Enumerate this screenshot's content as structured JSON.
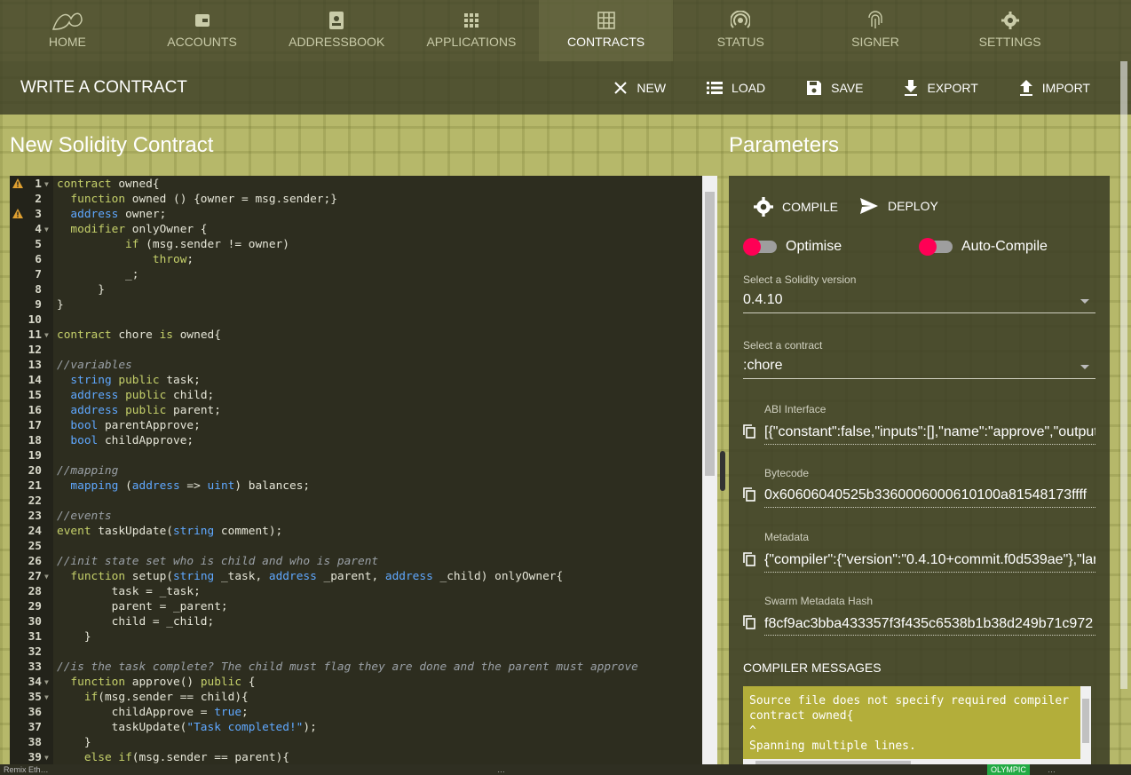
{
  "nav": {
    "items": [
      {
        "label": "HOME",
        "icon": "mist-logo-icon"
      },
      {
        "label": "ACCOUNTS",
        "icon": "wallet-icon"
      },
      {
        "label": "ADDRESSBOOK",
        "icon": "contact-book-icon"
      },
      {
        "label": "APPLICATIONS",
        "icon": "apps-grid-icon"
      },
      {
        "label": "CONTRACTS",
        "icon": "grid-table-icon",
        "active": true
      },
      {
        "label": "STATUS",
        "icon": "signal-icon"
      },
      {
        "label": "SIGNER",
        "icon": "fingerprint-icon"
      },
      {
        "label": "SETTINGS",
        "icon": "gear-icon"
      }
    ]
  },
  "toolbar": {
    "title": "WRITE A CONTRACT",
    "new_label": "NEW",
    "load_label": "LOAD",
    "save_label": "SAVE",
    "export_label": "EXPORT",
    "import_label": "IMPORT"
  },
  "editor": {
    "heading": "New Solidity Contract",
    "lines": [
      {
        "n": "1",
        "text": "contract owned{",
        "fold": true,
        "warn": true
      },
      {
        "n": "2",
        "text": "  function owned () {owner = msg.sender;}"
      },
      {
        "n": "3",
        "text": "  address owner;",
        "warn": true
      },
      {
        "n": "4",
        "text": "  modifier onlyOwner {",
        "fold": true
      },
      {
        "n": "5",
        "text": "          if (msg.sender != owner)"
      },
      {
        "n": "6",
        "text": "              throw;"
      },
      {
        "n": "7",
        "text": "          _;"
      },
      {
        "n": "8",
        "text": "      }"
      },
      {
        "n": "9",
        "text": "}"
      },
      {
        "n": "10",
        "text": ""
      },
      {
        "n": "11",
        "text": "contract chore is owned{",
        "fold": true
      },
      {
        "n": "12",
        "text": ""
      },
      {
        "n": "13",
        "text": "//variables"
      },
      {
        "n": "14",
        "text": "  string public task;"
      },
      {
        "n": "15",
        "text": "  address public child;"
      },
      {
        "n": "16",
        "text": "  address public parent;"
      },
      {
        "n": "17",
        "text": "  bool parentApprove;"
      },
      {
        "n": "18",
        "text": "  bool childApprove;"
      },
      {
        "n": "19",
        "text": ""
      },
      {
        "n": "20",
        "text": "//mapping"
      },
      {
        "n": "21",
        "text": "  mapping (address => uint) balances;"
      },
      {
        "n": "22",
        "text": ""
      },
      {
        "n": "23",
        "text": "//events"
      },
      {
        "n": "24",
        "text": "event taskUpdate(string comment);"
      },
      {
        "n": "25",
        "text": ""
      },
      {
        "n": "26",
        "text": "//init state set who is child and who is parent"
      },
      {
        "n": "27",
        "text": "  function setup(string _task, address _parent, address _child) onlyOwner{",
        "fold": true
      },
      {
        "n": "28",
        "text": "        task = _task;"
      },
      {
        "n": "29",
        "text": "        parent = _parent;"
      },
      {
        "n": "30",
        "text": "        child = _child;"
      },
      {
        "n": "31",
        "text": "    }"
      },
      {
        "n": "32",
        "text": ""
      },
      {
        "n": "33",
        "text": "//is the task complete? The child must flag they are done and the parent must approve"
      },
      {
        "n": "34",
        "text": "  function approve() public {",
        "fold": true
      },
      {
        "n": "35",
        "text": "    if(msg.sender == child){",
        "fold": true
      },
      {
        "n": "36",
        "text": "        childApprove = true;"
      },
      {
        "n": "37",
        "text": "        taskUpdate(\"Task completed!\");"
      },
      {
        "n": "38",
        "text": "    }"
      },
      {
        "n": "39",
        "text": "    else if(msg.sender == parent){",
        "fold": true
      }
    ]
  },
  "params": {
    "heading": "Parameters",
    "compile_label": "COMPILE",
    "deploy_label": "DEPLOY",
    "optimise_label": "Optimise",
    "autocompile_label": "Auto-Compile",
    "version_label": "Select a Solidity version",
    "version_value": "0.4.10",
    "contract_label": "Select a contract",
    "contract_value": ":chore",
    "abi_label": "ABI Interface",
    "abi_value": "[{\"constant\":false,\"inputs\":[],\"name\":\"approve\",\"outputs\":[",
    "bytecode_label": "Bytecode",
    "bytecode_value": "0x60606040525b3360006000610100a81548173ffff",
    "metadata_label": "Metadata",
    "metadata_value": "{\"compiler\":{\"version\":\"0.4.10+commit.f0d539ae\"},\"lang",
    "swarm_label": "Swarm Metadata Hash",
    "swarm_value": "f8cf9ac3bba433357f3f435c6538b1b38d249b71c972",
    "messages_heading": "COMPILER MESSAGES",
    "messages_text": "Source file does not specify required compiler\ncontract owned{\n^\nSpanning multiple lines."
  },
  "statusbar": {
    "left": "Remix Eth…",
    "middle": "…",
    "chip": "OLYMPIC",
    "right": "…"
  },
  "colors": {
    "keyword": "#c5d06a",
    "type": "#5fa8ff",
    "comment": "#9aa0a6",
    "string": "#5fa8ff",
    "accent_toggle": "#ff0055",
    "message_bg": "#b3ae3a"
  }
}
